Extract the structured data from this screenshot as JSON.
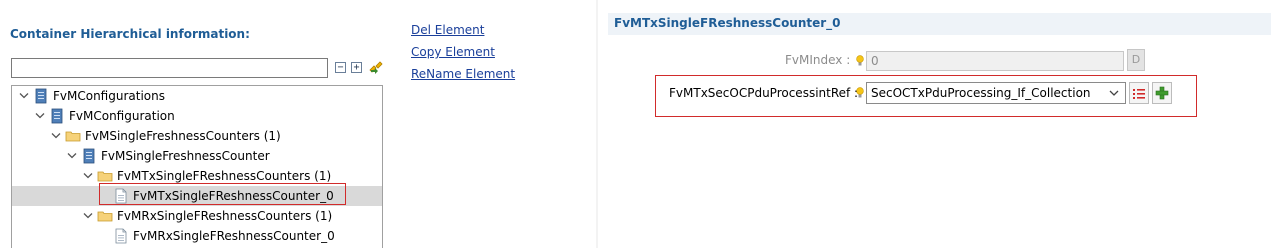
{
  "left_panel": {
    "title": "Container Hierarchical information:",
    "filter": {
      "value": "",
      "placeholder": ""
    },
    "toolbar": {
      "collapse_all_icon": "collapse-all-icon",
      "expand_all_icon": "expand-all-icon",
      "sync_icon": "link-sync-icon"
    },
    "tree": [
      {
        "label": "FvMConfigurations",
        "level": 0,
        "expanded": true,
        "icon": "module-icon"
      },
      {
        "label": "FvMConfiguration",
        "level": 1,
        "expanded": true,
        "icon": "module-icon"
      },
      {
        "label": "FvMSingleFreshnessCounters (1)",
        "level": 2,
        "expanded": true,
        "icon": "folder-icon"
      },
      {
        "label": "FvMSingleFreshnessCounter",
        "level": 3,
        "expanded": true,
        "icon": "module-icon"
      },
      {
        "label": "FvMTxSingleFReshnessCounters (1)",
        "level": 4,
        "expanded": true,
        "icon": "folder-icon"
      },
      {
        "label": "FvMTxSingleFReshnessCounter_0",
        "level": 5,
        "selected": true,
        "icon": "file-icon"
      },
      {
        "label": "FvMRxSingleFReshnessCounters (1)",
        "level": 4,
        "expanded": true,
        "icon": "folder-icon"
      },
      {
        "label": "FvMRxSingleFReshnessCounter_0",
        "level": 5,
        "icon": "file-icon"
      }
    ]
  },
  "actions": {
    "del": "Del Element",
    "copy": "Copy Element",
    "rename": "ReName Element"
  },
  "form": {
    "title": "FvMTxSingleFReshnessCounter_0",
    "fvmindex": {
      "label": "FvMIndex :",
      "value": "0",
      "default_btn": "D"
    },
    "ref": {
      "label": "FvMTxSecOCPduProcessintRef :",
      "value": "SecOCTxPduProcessing_If_Collection"
    }
  },
  "colors": {
    "title_blue": "#1f5d96",
    "link_blue": "#1a3f9a",
    "highlight_red": "#d12b2b",
    "selection_gray": "#d9d9d9"
  }
}
